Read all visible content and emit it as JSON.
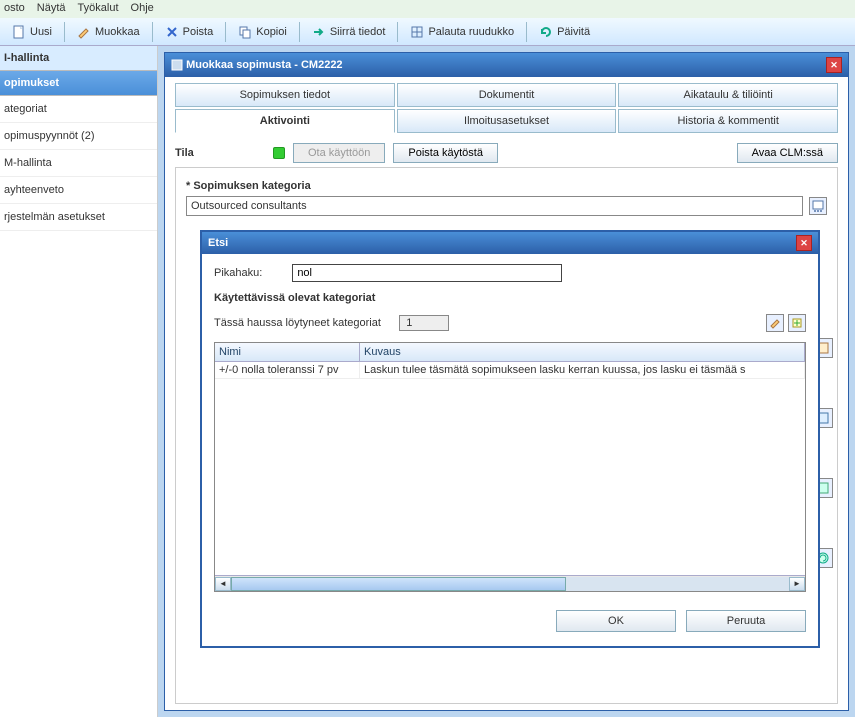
{
  "menubar": {
    "items": [
      "osto",
      "Näytä",
      "Työkalut",
      "Ohje"
    ]
  },
  "toolbar": {
    "new": "Uusi",
    "edit": "Muokkaa",
    "delete": "Poista",
    "copy": "Kopioi",
    "move": "Siirrä tiedot",
    "restore": "Palauta ruudukko",
    "refresh": "Päivitä"
  },
  "sidebar": {
    "header": "I-hallinta",
    "active": "opimukset",
    "items": [
      "ategoriat",
      "opimuspyynnöt (2)",
      "M-hallinta",
      "ayhteenveto",
      "rjestelmän asetukset"
    ]
  },
  "dialog": {
    "title": "Muokkaa sopimusta - CM2222",
    "tabs1": [
      "Sopimuksen tiedot",
      "Dokumentit",
      "Aikataulu & tiliöinti"
    ],
    "tabs2": [
      "Aktivointi",
      "Ilmoitusasetukset",
      "Historia & kommentit"
    ],
    "active_tab": "Aktivointi",
    "status_label": "Tila",
    "btn_enable": "Ota käyttöön",
    "btn_disable": "Poista käytöstä",
    "btn_openclm": "Avaa CLM:ssä",
    "category_label": "* Sopimuksen kategoria",
    "category_value": "Outsourced consultants"
  },
  "popup": {
    "title": "Etsi",
    "quicksearch_label": "Pikahaku:",
    "quicksearch_value": "nol",
    "available_label": "Käytettävissä olevat kategoriat",
    "found_label": "Tässä haussa löytyneet kategoriat",
    "found_count": "1",
    "col_name": "Nimi",
    "col_desc": "Kuvaus",
    "rows": [
      {
        "name": "+/-0 nolla toleranssi 7 pv",
        "desc": "Laskun tulee täsmätä sopimukseen lasku kerran kuussa, jos lasku ei täsmää s"
      }
    ],
    "ok": "OK",
    "cancel": "Peruuta"
  }
}
